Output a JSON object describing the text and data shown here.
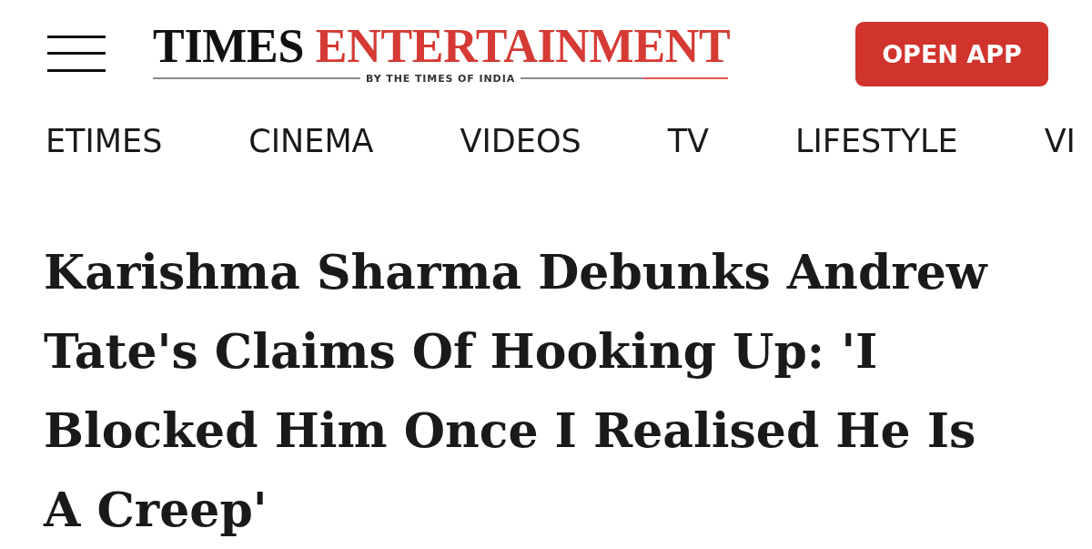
{
  "header": {
    "logo": {
      "word_1": "TIMES",
      "word_2": "ENTERTAINMENT",
      "tagline": "BY THE TIMES OF INDIA"
    },
    "open_app_button": "OPEN APP"
  },
  "nav": {
    "items": [
      "ETIMES",
      "CINEMA",
      "VIDEOS",
      "TV",
      "LIFESTYLE",
      "VI"
    ]
  },
  "article": {
    "headline": "Karishma Sharma Debunks Andrew Tate's Claims Of Hooking Up: 'I Blocked Him Once I Realised He Is A Creep'"
  }
}
